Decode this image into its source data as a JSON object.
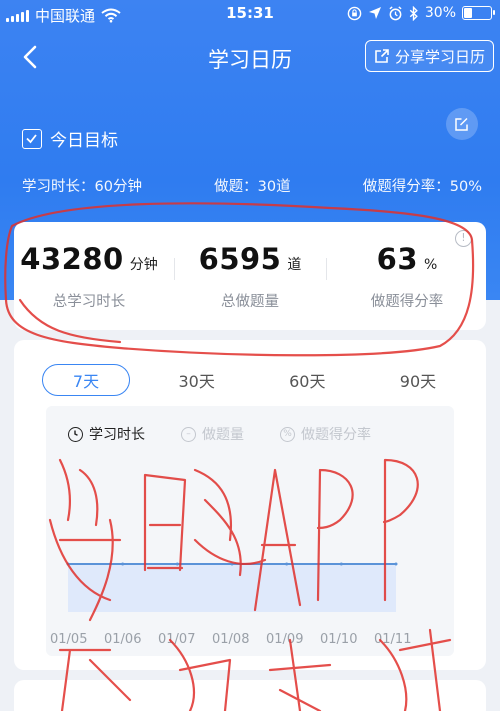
{
  "status_bar": {
    "carrier": "中国联通",
    "time": "15:31",
    "battery": "30%"
  },
  "nav": {
    "title": "学习日历",
    "share_label": "分享学习日历"
  },
  "goal": {
    "title": "今日目标",
    "items": [
      {
        "label": "学习时长：60分钟"
      },
      {
        "label": "做题：30道"
      },
      {
        "label": "做题得分率：50%"
      }
    ]
  },
  "totals": [
    {
      "value": "43280",
      "unit": "分钟",
      "label": "总学习时长"
    },
    {
      "value": "6595",
      "unit": "道",
      "label": "总做题量"
    },
    {
      "value": "63",
      "unit": "%",
      "label": "做题得分率"
    }
  ],
  "period_tabs": [
    "7天",
    "30天",
    "60天",
    "90天"
  ],
  "active_period": 0,
  "metric_tabs": [
    "学习时长",
    "做题量",
    "做题得分率"
  ],
  "active_metric": 0,
  "chart_data": {
    "type": "area",
    "categories": [
      "01/05",
      "01/06",
      "01/07",
      "01/08",
      "01/09",
      "01/10",
      "01/11"
    ],
    "series": [
      {
        "values": [
          0,
          0,
          0,
          0,
          0,
          0,
          0
        ]
      }
    ]
  },
  "colors": {
    "primary": "#3a86f3",
    "annotation": "#e0302c"
  },
  "icons": {
    "back": "chevron-left-icon",
    "share": "share-icon",
    "edit": "edit-icon",
    "info": "info-icon",
    "clock": "clock-icon"
  }
}
